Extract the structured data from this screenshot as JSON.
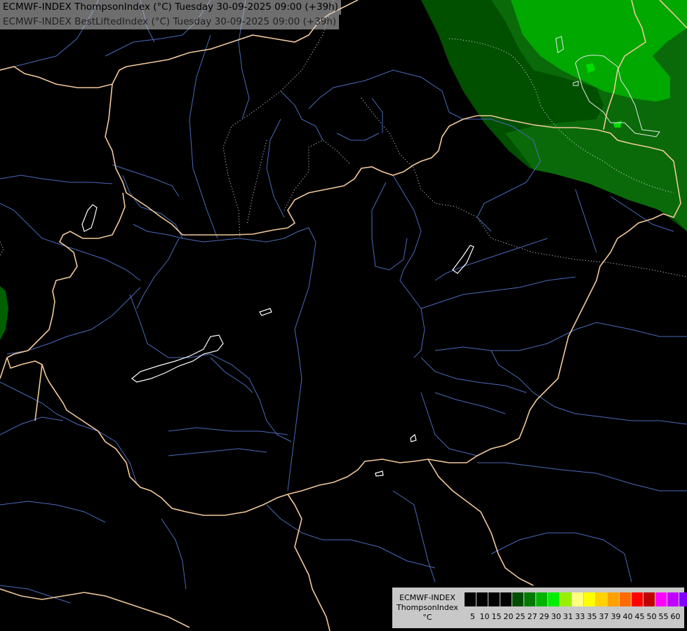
{
  "header": {
    "line1": "ECMWF-INDEX ThompsonIndex (°C) Tuesday 30-09-2025 09:00 (+39h)",
    "line2": "ECMWF-INDEX BestLiftedIndex (°C) Tuesday 30-09-2025 09:00 (+39h)"
  },
  "legend": {
    "title": "ECMWF-INDEX",
    "subtitle": "ThompsonIndex",
    "unit": "°C",
    "colors": [
      "#000000",
      "#000000",
      "#000000",
      "#000000",
      "#004d00",
      "#007a00",
      "#00b400",
      "#00ee00",
      "#98f000",
      "#ffff80",
      "#ffff00",
      "#ffd200",
      "#ffa000",
      "#ff6a00",
      "#ff0000",
      "#c00000",
      "#ff00ff",
      "#c000ff",
      "#8000ff",
      "#6000ff",
      "#0000ff"
    ],
    "ticks": [
      "5",
      "10",
      "15",
      "20",
      "25",
      "27",
      "29",
      "30",
      "31",
      "33",
      "35",
      "37",
      "39",
      "40",
      "45",
      "50",
      "55",
      "60"
    ]
  },
  "map_colors": {
    "background": "#000000",
    "border": "#f0c89a",
    "river": "#4a6ab8",
    "lake": "#ffffff",
    "contour": "#e8e8e8",
    "fill_dark": "#005000",
    "fill_mid": "#007800",
    "fill_light": "#00a800",
    "fill_bright": "#00dd00"
  }
}
